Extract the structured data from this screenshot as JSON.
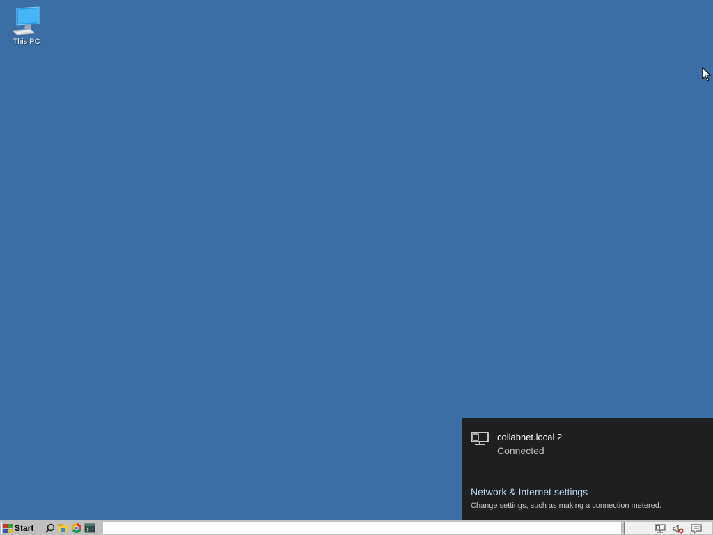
{
  "desktop": {
    "icons": [
      {
        "label": "This PC",
        "icon": "computer-icon"
      }
    ],
    "background_color": "#3a6ea5"
  },
  "network_flyout": {
    "network_name": "collabnet.local 2",
    "network_status": "Connected",
    "network_icon": "wired-network-icon",
    "settings_link": "Network & Internet settings",
    "settings_description": "Change settings, such as making a connection metered.",
    "background_color": "#1f1f1f",
    "link_color": "#b8d4f0"
  },
  "taskbar": {
    "start_label": "Start",
    "quick_launch": [
      {
        "icon": "search-icon"
      },
      {
        "icon": "file-explorer-icon"
      },
      {
        "icon": "chrome-icon"
      },
      {
        "icon": "terminal-icon"
      }
    ],
    "tray": [
      {
        "icon": "network-icon"
      },
      {
        "icon": "volume-muted-icon"
      },
      {
        "icon": "notifications-icon"
      }
    ]
  }
}
